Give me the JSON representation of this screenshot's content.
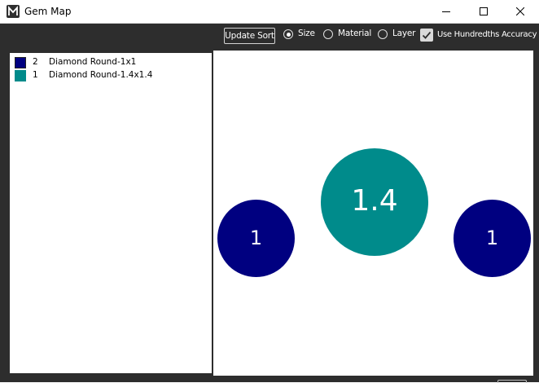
{
  "window": {
    "title": "Gem Map",
    "controls": [
      "minimize-icon",
      "maximize-icon",
      "close-icon"
    ]
  },
  "toolbar": {
    "update_sort_label": "Update Sort",
    "sort_options": [
      {
        "label": "Size",
        "checked": true
      },
      {
        "label": "Material",
        "checked": false
      },
      {
        "label": "Layer",
        "checked": false
      }
    ],
    "hundredths": {
      "label": "Use Hundredths Accuracy",
      "checked": true
    }
  },
  "legend": {
    "items": [
      {
        "count": "2",
        "name": "Diamond Round-1x1",
        "color": "#000080"
      },
      {
        "count": "1",
        "name": "Diamond Round-1.4x1.4",
        "color": "#008B8B"
      }
    ]
  },
  "gems": [
    {
      "label": "1",
      "size": 1.0,
      "color": "#000080"
    },
    {
      "label": "1.4",
      "size": 1.4,
      "color": "#008B8B"
    },
    {
      "label": "1",
      "size": 1.0,
      "color": "#000080"
    }
  ],
  "colors": {
    "toolbar_bg": "#2d2d2d",
    "navy": "#000080",
    "teal": "#008B8B"
  }
}
